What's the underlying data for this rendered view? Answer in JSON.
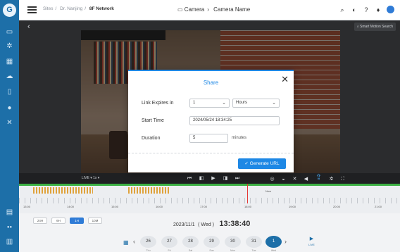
{
  "sidebar": {
    "logo": "G",
    "items": [
      {
        "icon": "monitor-icon",
        "glyph": "▭"
      },
      {
        "icon": "settings-icon",
        "glyph": "✲"
      },
      {
        "icon": "grid-icon",
        "glyph": "▦"
      },
      {
        "icon": "cloud-icon",
        "glyph": "☁"
      },
      {
        "icon": "device-icon",
        "glyph": "▯"
      },
      {
        "icon": "user-icon",
        "glyph": "●"
      },
      {
        "icon": "tools-icon",
        "glyph": "✕"
      }
    ],
    "bottom_items": [
      {
        "icon": "document-icon",
        "glyph": "▤"
      },
      {
        "icon": "users-icon",
        "glyph": "●●"
      },
      {
        "icon": "building-icon",
        "glyph": "▥"
      }
    ]
  },
  "header": {
    "breadcrumb": [
      "Sites",
      "Dr. Nanjing",
      "8F Network"
    ],
    "camera_path": [
      "Camera",
      "Camera Name"
    ],
    "icons": [
      "search-icon",
      "theme-icon",
      "help-icon",
      "bell-icon",
      "avatar"
    ]
  },
  "viewer": {
    "smart_search_label": "Smart Motion Search"
  },
  "share_dialog": {
    "title": "Share",
    "link_expires_label": "Link Expires in",
    "link_expires_value": "1",
    "link_expires_unit": "Hours",
    "start_time_label": "Start Time",
    "start_time_value": "2024/05/24 18:34:25",
    "duration_label": "Duration",
    "duration_value": "5",
    "duration_unit": "minutes",
    "generate_button": "Generate URL"
  },
  "controls": {
    "live_label": "LIVE ▾  1x ▾"
  },
  "timeline": {
    "now_label": "Now",
    "tick_labels": [
      "13:00",
      "14:00",
      "15:00",
      "16:00",
      "17:00",
      "18:00",
      "19:00",
      "20:00",
      "21:00"
    ]
  },
  "bottom": {
    "zoom_options": [
      "24H",
      "6H",
      "1H",
      "10M"
    ],
    "zoom_selected": "1H",
    "date": "2023/11/1",
    "weekday": "( Wed )",
    "time": "13:38:40",
    "days": [
      {
        "num": "26",
        "sub": "Thu"
      },
      {
        "num": "27",
        "sub": "Fri"
      },
      {
        "num": "28",
        "sub": "Sat"
      },
      {
        "num": "29",
        "sub": "Sun"
      },
      {
        "num": "30",
        "sub": "Mon"
      },
      {
        "num": "31",
        "sub": "Tue"
      },
      {
        "num": "1",
        "sub": "Wed"
      }
    ],
    "active_day": "1",
    "live_label": "LIVE"
  },
  "colors": {
    "brand": "#1d6fa8",
    "accent": "#1e88e5",
    "recording": "#e0a23a",
    "timeline_ok": "#3cb043",
    "cursor": "#e53935"
  }
}
